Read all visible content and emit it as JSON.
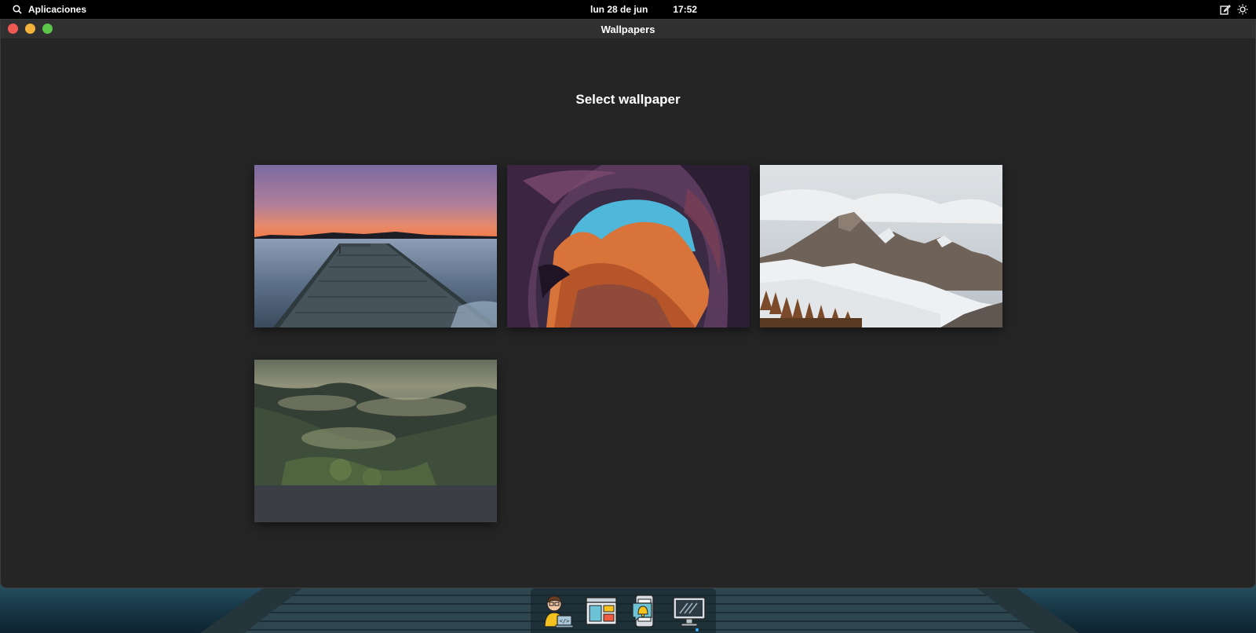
{
  "topbar": {
    "apps_label": "Aplicaciones",
    "date": "lun 28 de jun",
    "time": "17:52",
    "icons": [
      "search-icon",
      "edit-icon",
      "brightness-icon"
    ]
  },
  "window": {
    "title": "Wallpapers",
    "controls": [
      "close",
      "minimize",
      "maximize"
    ],
    "controls_colors": [
      "#ee5a52",
      "#f2b33c",
      "#5cc64a"
    ]
  },
  "main": {
    "heading": "Select wallpaper"
  },
  "dock": {
    "apps": [
      "developer-app-icon",
      "layout-app-icon",
      "notifications-app-icon",
      "display-app-icon"
    ],
    "active_indicator_color": "#3ab0ff"
  },
  "colors": {
    "window_bg": "#252525",
    "titlebar_bg": "#303030",
    "topbar_bg": "#000000"
  }
}
